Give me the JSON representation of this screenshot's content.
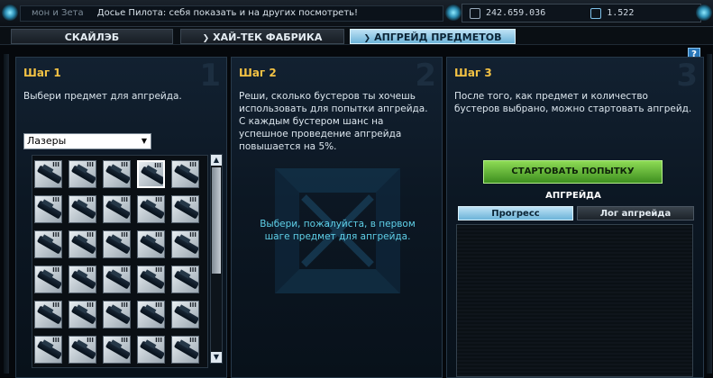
{
  "topbar": {
    "news_prefix": "мон и Зета",
    "news_text": "Досье Пилота: себя показать и на других посмотреть!",
    "credits": "242.659.036",
    "uridium": "1.522",
    "credits_icon": "credits-icon",
    "uridium_icon": "uridium-icon"
  },
  "tabs": [
    {
      "label": "СКАЙЛЭБ"
    },
    {
      "label": "ХАЙ-ТЕК ФАБРИКА"
    },
    {
      "label": "АПГРЕЙД ПРЕДМЕТОВ"
    }
  ],
  "help_label": "?",
  "step1": {
    "title": "Шаг 1",
    "number": "1",
    "text": "Выбери предмет для апгрейда.",
    "dropdown_value": "Лазеры",
    "items_tier": "III"
  },
  "step2": {
    "title": "Шаг 2",
    "number": "2",
    "text": "Реши, сколько бустеров ты хочешь использовать для попытки апгрейда. С каждым бустером шанс на успешное проведение апгрейда повышается на 5%.",
    "hint": "Выбери, пожалуйста, в первом шаге предмет для апгрейда."
  },
  "step3": {
    "title": "Шаг 3",
    "number": "3",
    "text": "После того, как предмет и количество бустеров выбрано, можно стартовать апгрейд.",
    "start_button": "СТАРТОВАТЬ ПОПЫТКУ",
    "section_label": "АПГРЕЙДА",
    "subtab_progress": "Прогресс",
    "subtab_log": "Лог апгрейда"
  },
  "colors": {
    "accent_gold": "#f3c244",
    "tab_active": "#8cc8e6",
    "start_green": "#5cb532",
    "hint_cyan": "#5fd0e8"
  }
}
